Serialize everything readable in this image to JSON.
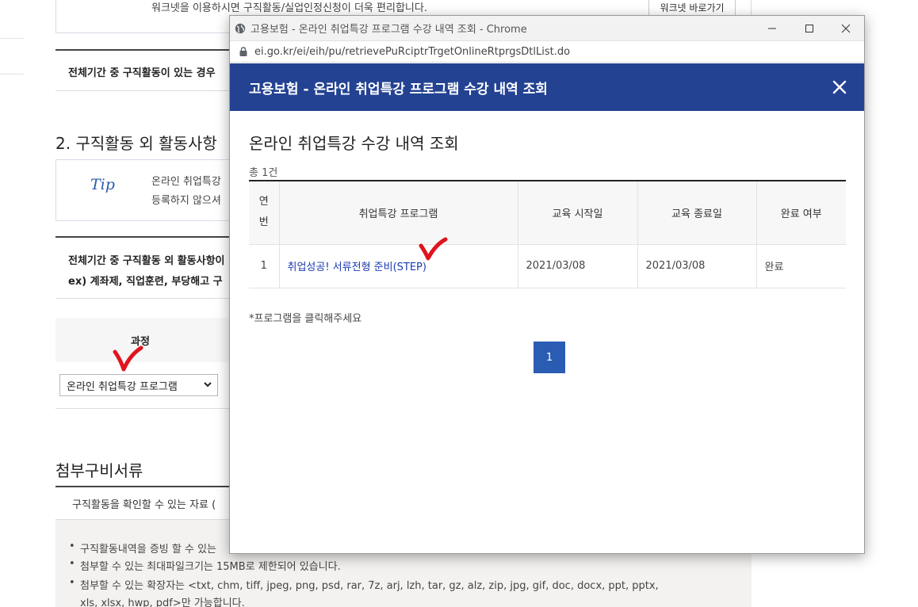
{
  "background": {
    "notice_text": "워크넷을 이용하시면 구직활동/실업인정신청이 더욱 편리합니다.",
    "worknet_button": "워크넷 바로가기",
    "period_row_1": "전체기간 중 구직활동이 있는 경우",
    "section_2_title": "2. 구직활동 외 활동사항",
    "tip_label": "Tip",
    "tip_line_1": "온라인 취업특강",
    "tip_line_2": "등록하지 않으셔",
    "period_row_2a": "전체기간 중 구직활동 외 활동사항이",
    "period_row_2b": "ex) 계좌제, 직업훈련, 부당해고 구",
    "course_label": "과정",
    "course_select": "온라인 취업특강 프로그램",
    "attach_title": "첨부구비서류",
    "attach_header": "구직활동을 확인할 수 있는 자료 (",
    "bullets": [
      "구직활동내역을 증빙 할 수 있는",
      "첨부할 수 있는 최대파일크기는 15MB로 제한되어 있습니다.",
      "첨부할 수 있는 확장자는 <txt, chm, tiff, jpeg, png, psd, rar, 7z, arj, lzh, tar, gz, alz, zip, jpg, gif, doc, docx, ppt, pptx,"
    ],
    "bullet_continuation": "xls, xlsx, hwp, pdf>만 가능합니다."
  },
  "popup": {
    "window_title": "고용보험 - 온라인 취업특강 프로그램 수강 내역 조회 - Chrome",
    "url": "ei.go.kr/ei/eih/pu/retrievePuRciptrTrgetOnlineRtprgsDtlList.do",
    "header_title": "고용보험 - 온라인 취업특강 프로그램 수강 내역 조회",
    "page_title": "온라인 취업특강 수강 내역 조회",
    "total_count": "총 1건",
    "columns": [
      "연번",
      "취업특강 프로그램",
      "교육 시작일",
      "교육 종료일",
      "완료 여부"
    ],
    "rows": [
      {
        "no": "1",
        "program": "취업성공! 서류전형 준비(STEP)",
        "start": "2021/03/08",
        "end": "2021/03/08",
        "status": "완료"
      }
    ],
    "note": "*프로그램을 클릭해주세요",
    "page_number": "1"
  },
  "colors": {
    "header_bg": "#234292",
    "pagination_bg": "#2a5cb3",
    "link": "#1a3bb0",
    "annotation_check": "#e0141e"
  },
  "icons": {
    "globe": "globe-icon",
    "lock": "lock-icon",
    "close": "close-icon",
    "minimize": "minimize-icon",
    "maximize": "maximize-icon",
    "chevron": "chevron-down-icon",
    "annotation": "red-checkmark-icon"
  }
}
